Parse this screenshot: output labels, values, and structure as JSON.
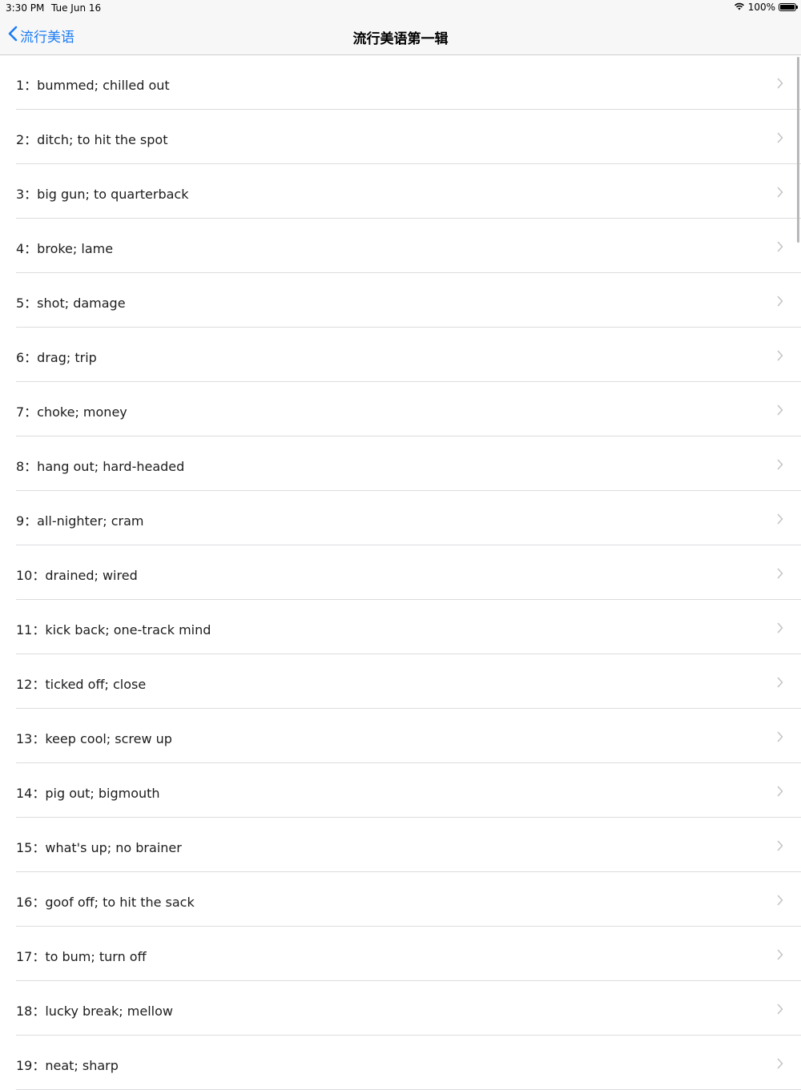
{
  "status_bar": {
    "time": "3:30 PM",
    "date": "Tue Jun 16",
    "battery_text": "100%",
    "icons": [
      "wifi-icon",
      "battery-icon"
    ]
  },
  "nav": {
    "back_label": "流行美语",
    "title": "流行美语第一辑",
    "accent_color": "#1a7cf5"
  },
  "items": [
    {
      "label": "1：bummed; chilled out"
    },
    {
      "label": "2：ditch; to hit the spot"
    },
    {
      "label": "3：big gun; to quarterback"
    },
    {
      "label": "4：broke; lame"
    },
    {
      "label": "5：shot; damage"
    },
    {
      "label": "6：drag; trip"
    },
    {
      "label": "7：choke; money"
    },
    {
      "label": "8：hang out; hard-headed"
    },
    {
      "label": "9：all-nighter; cram"
    },
    {
      "label": "10：drained; wired"
    },
    {
      "label": "11：kick back; one-track mind"
    },
    {
      "label": "12：ticked off; close"
    },
    {
      "label": "13：keep cool; screw up"
    },
    {
      "label": "14：pig out; bigmouth"
    },
    {
      "label": "15：what's up; no brainer"
    },
    {
      "label": "16：goof off; to hit the sack"
    },
    {
      "label": "17：to bum; turn off"
    },
    {
      "label": "18：lucky break; mellow"
    },
    {
      "label": "19：neat; sharp"
    }
  ]
}
